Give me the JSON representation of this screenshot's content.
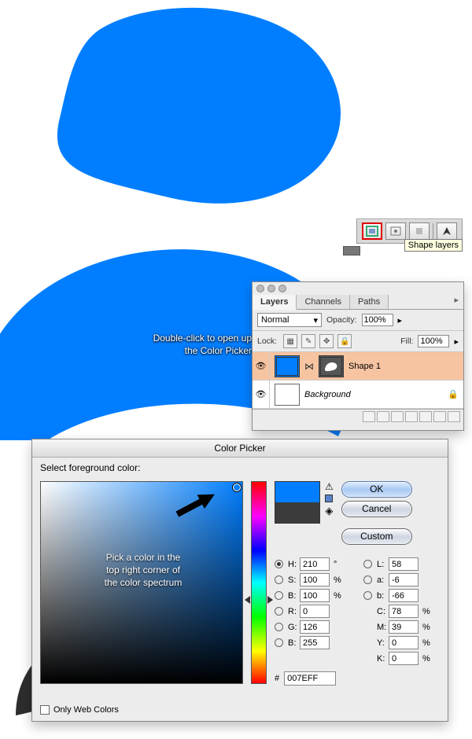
{
  "toolbar": {
    "tooltip": "Shape layers"
  },
  "annotations": {
    "double_click_line1": "Double-click to open up",
    "double_click_line2": "the Color Picker",
    "spectrum_line1": "Pick a color in the",
    "spectrum_line2": "top right corner of",
    "spectrum_line3": "the color spectrum"
  },
  "layers": {
    "tabs": [
      "Layers",
      "Channels",
      "Paths"
    ],
    "blend_mode": "Normal",
    "opacity_label": "Opacity:",
    "opacity_value": "100%",
    "lock_label": "Lock:",
    "fill_label": "Fill:",
    "fill_value": "100%",
    "items": [
      {
        "name": "Shape 1",
        "italic": false
      },
      {
        "name": "Background",
        "italic": true
      }
    ],
    "lock_glyph": "🔒"
  },
  "picker": {
    "title": "Color Picker",
    "subtitle": "Select foreground color:",
    "ok": "OK",
    "cancel": "Cancel",
    "custom": "Custom",
    "fields": {
      "H": "210",
      "H_unit": "°",
      "S": "100",
      "S_unit": "%",
      "B": "100",
      "B_unit": "%",
      "L": "58",
      "a": "-6",
      "b2": "-66",
      "R": "0",
      "G": "126",
      "Bc": "255",
      "C": "78",
      "M": "39",
      "Y": "0",
      "K": "0",
      "pct": "%"
    },
    "hex_label": "#",
    "hex": "007EFF",
    "web_only": "Only Web Colors"
  }
}
